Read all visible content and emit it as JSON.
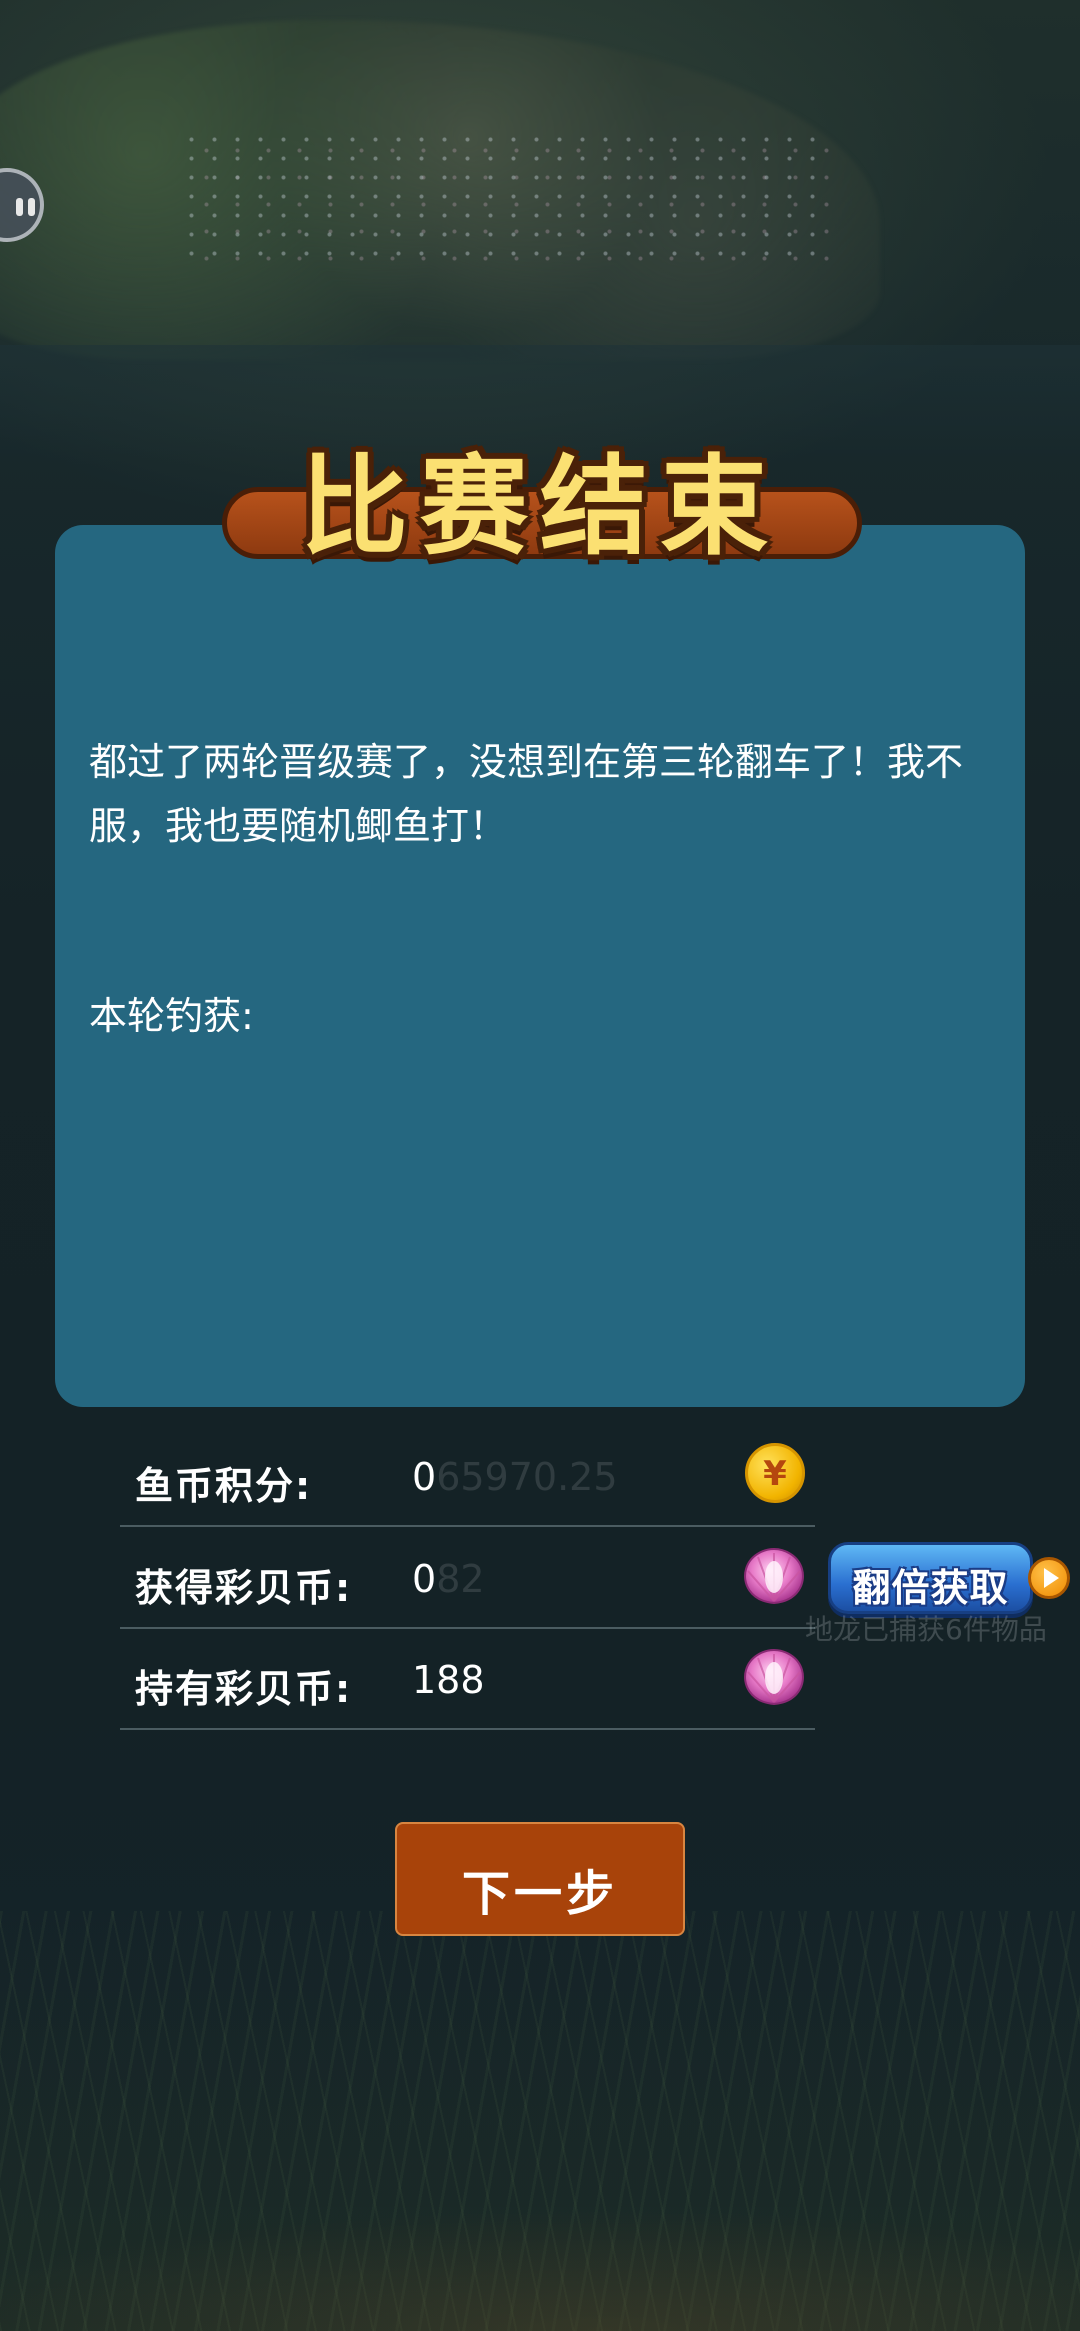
{
  "title": "比赛结束",
  "story": "都过了两轮晋级赛了，没想到在第三轮翻车了！我不服，我也要随机鲫鱼打！",
  "catch_label": "本轮钓获:",
  "stats": [
    {
      "label": "鱼币积分:",
      "value": "0",
      "rolling": "65970.25",
      "icon": "coin-icon"
    },
    {
      "label": "获得彩贝币:",
      "value": "0",
      "rolling": "82",
      "icon": "shell-icon"
    },
    {
      "label": "持有彩贝币:",
      "value": "188",
      "rolling": "",
      "icon": "shell-icon"
    }
  ],
  "double_button": "翻倍获取",
  "caught_notice": "地龙已捕获6件物品",
  "next_button": "下一步",
  "colors": {
    "panel": "#256780",
    "title": "#fbe072",
    "next_button": "#a8430a",
    "background": "#15262b"
  }
}
